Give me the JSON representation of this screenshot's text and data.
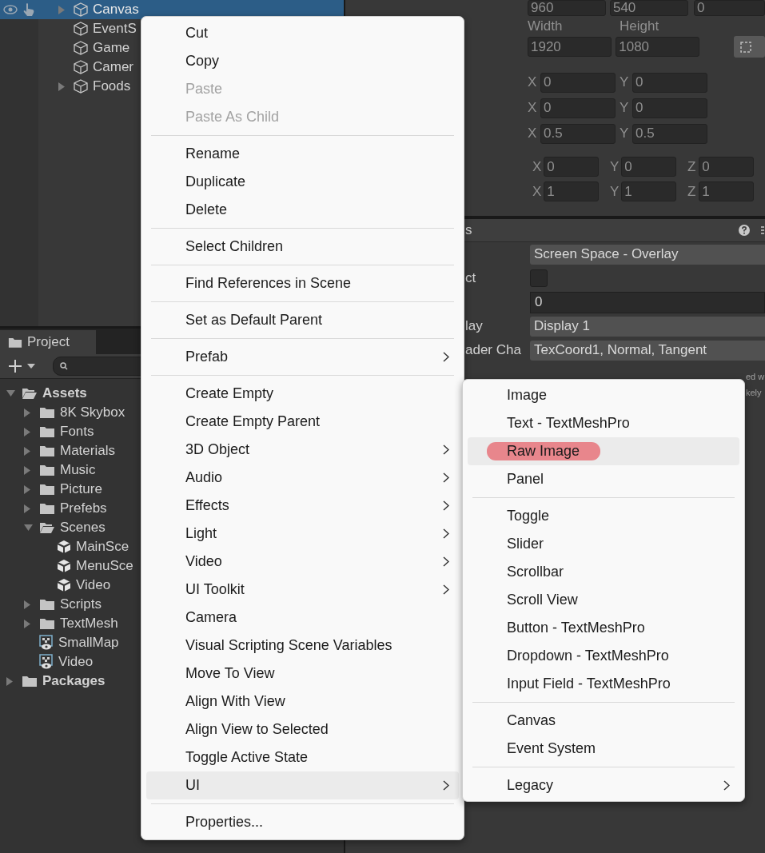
{
  "hierarchy": {
    "items": [
      {
        "label": "Canvas",
        "expandable": true,
        "selected": true
      },
      {
        "label": "EventS",
        "expandable": false,
        "selected": false
      },
      {
        "label": "Game",
        "expandable": false,
        "selected": false
      },
      {
        "label": "Camer",
        "expandable": false,
        "selected": false
      },
      {
        "label": "Foods",
        "expandable": true,
        "selected": false
      }
    ]
  },
  "project": {
    "tab": "Project",
    "tree": [
      {
        "label": "Assets",
        "kind": "folder",
        "expanded": true,
        "children": [
          {
            "label": "8K Skybox",
            "kind": "folder",
            "expanded": false
          },
          {
            "label": "Fonts",
            "kind": "folder",
            "expanded": false
          },
          {
            "label": "Materials",
            "kind": "folder",
            "expanded": false
          },
          {
            "label": "Music",
            "kind": "folder",
            "expanded": false
          },
          {
            "label": "Picture",
            "kind": "folder",
            "expanded": false
          },
          {
            "label": "Prefebs",
            "kind": "folder",
            "expanded": false
          },
          {
            "label": "Scenes",
            "kind": "folder",
            "expanded": true,
            "children": [
              {
                "label": "MainSce",
                "kind": "scene"
              },
              {
                "label": "MenuSce",
                "kind": "scene"
              },
              {
                "label": "Video",
                "kind": "scene"
              }
            ]
          },
          {
            "label": "Scripts",
            "kind": "folder",
            "expanded": false
          },
          {
            "label": "TextMesh",
            "kind": "folder",
            "expanded": false
          },
          {
            "label": "SmallMap",
            "kind": "render_texture"
          },
          {
            "label": "Video",
            "kind": "render_texture"
          }
        ]
      },
      {
        "label": "Packages",
        "kind": "folder",
        "expanded": false
      }
    ]
  },
  "inspector": {
    "top_fields": [
      "960",
      "540",
      "0"
    ],
    "size_labels": [
      "Width",
      "Height"
    ],
    "size_fields": [
      "1920",
      "1080"
    ],
    "vec2_rows": [
      [
        {
          "axis": "X",
          "value": "0"
        },
        {
          "axis": "Y",
          "value": "0"
        }
      ],
      [
        {
          "axis": "X",
          "value": "0"
        },
        {
          "axis": "Y",
          "value": "0"
        }
      ],
      [
        {
          "axis": "X",
          "value": "0.5"
        },
        {
          "axis": "Y",
          "value": "0.5"
        }
      ]
    ],
    "vec3_rows": [
      [
        {
          "axis": "X",
          "value": "0"
        },
        {
          "axis": "Y",
          "value": "0"
        },
        {
          "axis": "Z",
          "value": "0"
        }
      ],
      [
        {
          "axis": "X",
          "value": "1"
        },
        {
          "axis": "Y",
          "value": "1"
        },
        {
          "axis": "Z",
          "value": "1"
        }
      ]
    ],
    "component": {
      "title": "s",
      "rows": [
        {
          "label": "",
          "kind": "dropdown",
          "value": "Screen Space - Overlay"
        },
        {
          "label": "ct",
          "kind": "checkbox",
          "checked": false
        },
        {
          "label": "",
          "kind": "number",
          "value": "0"
        },
        {
          "label": "lay",
          "kind": "dropdown",
          "value": "Display 1"
        },
        {
          "label": "ader Cha",
          "kind": "dropdown",
          "value": "TexCoord1, Normal, Tangent"
        }
      ],
      "notes": [
        "ed w",
        "kely"
      ]
    }
  },
  "menu": {
    "items": [
      {
        "kind": "item",
        "label": "Cut",
        "disabled": false,
        "submenu": false,
        "selected": false
      },
      {
        "kind": "item",
        "label": "Copy",
        "disabled": false,
        "submenu": false,
        "selected": false
      },
      {
        "kind": "item",
        "label": "Paste",
        "disabled": true,
        "submenu": false,
        "selected": false
      },
      {
        "kind": "item",
        "label": "Paste As Child",
        "disabled": true,
        "submenu": false,
        "selected": false
      },
      {
        "kind": "separator"
      },
      {
        "kind": "item",
        "label": "Rename",
        "disabled": false,
        "submenu": false,
        "selected": false
      },
      {
        "kind": "item",
        "label": "Duplicate",
        "disabled": false,
        "submenu": false,
        "selected": false
      },
      {
        "kind": "item",
        "label": "Delete",
        "disabled": false,
        "submenu": false,
        "selected": false
      },
      {
        "kind": "separator"
      },
      {
        "kind": "item",
        "label": "Select Children",
        "disabled": false,
        "submenu": false,
        "selected": false
      },
      {
        "kind": "separator"
      },
      {
        "kind": "item",
        "label": "Find References in Scene",
        "disabled": false,
        "submenu": false,
        "selected": false
      },
      {
        "kind": "separator"
      },
      {
        "kind": "item",
        "label": "Set as Default Parent",
        "disabled": false,
        "submenu": false,
        "selected": false
      },
      {
        "kind": "separator"
      },
      {
        "kind": "item",
        "label": "Prefab",
        "disabled": false,
        "submenu": true,
        "selected": false
      },
      {
        "kind": "separator"
      },
      {
        "kind": "item",
        "label": "Create Empty",
        "disabled": false,
        "submenu": false,
        "selected": false
      },
      {
        "kind": "item",
        "label": "Create Empty Parent",
        "disabled": false,
        "submenu": false,
        "selected": false
      },
      {
        "kind": "item",
        "label": "3D Object",
        "disabled": false,
        "submenu": true,
        "selected": false
      },
      {
        "kind": "item",
        "label": "Audio",
        "disabled": false,
        "submenu": true,
        "selected": false
      },
      {
        "kind": "item",
        "label": "Effects",
        "disabled": false,
        "submenu": true,
        "selected": false
      },
      {
        "kind": "item",
        "label": "Light",
        "disabled": false,
        "submenu": true,
        "selected": false
      },
      {
        "kind": "item",
        "label": "Video",
        "disabled": false,
        "submenu": true,
        "selected": false
      },
      {
        "kind": "item",
        "label": "UI Toolkit",
        "disabled": false,
        "submenu": true,
        "selected": false
      },
      {
        "kind": "item",
        "label": "Camera",
        "disabled": false,
        "submenu": false,
        "selected": false
      },
      {
        "kind": "item",
        "label": "Visual Scripting Scene Variables",
        "disabled": false,
        "submenu": false,
        "selected": false
      },
      {
        "kind": "item",
        "label": "Move To View",
        "disabled": false,
        "submenu": false,
        "selected": false
      },
      {
        "kind": "item",
        "label": "Align With View",
        "disabled": false,
        "submenu": false,
        "selected": false
      },
      {
        "kind": "item",
        "label": "Align View to Selected",
        "disabled": false,
        "submenu": false,
        "selected": false
      },
      {
        "kind": "item",
        "label": "Toggle Active State",
        "disabled": false,
        "submenu": false,
        "selected": false
      },
      {
        "kind": "item",
        "label": "UI",
        "disabled": false,
        "submenu": true,
        "selected": true
      },
      {
        "kind": "separator"
      },
      {
        "kind": "item",
        "label": "Properties...",
        "disabled": false,
        "submenu": false,
        "selected": false
      }
    ]
  },
  "submenu": {
    "items": [
      {
        "kind": "item",
        "label": "Image",
        "submenu": false,
        "selected": false,
        "marked": false
      },
      {
        "kind": "item",
        "label": "Text - TextMeshPro",
        "submenu": false,
        "selected": false,
        "marked": false
      },
      {
        "kind": "item",
        "label": "Raw Image",
        "submenu": false,
        "selected": true,
        "marked": true
      },
      {
        "kind": "item",
        "label": "Panel",
        "submenu": false,
        "selected": false,
        "marked": false
      },
      {
        "kind": "separator"
      },
      {
        "kind": "item",
        "label": "Toggle",
        "submenu": false,
        "selected": false,
        "marked": false
      },
      {
        "kind": "item",
        "label": "Slider",
        "submenu": false,
        "selected": false,
        "marked": false
      },
      {
        "kind": "item",
        "label": "Scrollbar",
        "submenu": false,
        "selected": false,
        "marked": false
      },
      {
        "kind": "item",
        "label": "Scroll View",
        "submenu": false,
        "selected": false,
        "marked": false
      },
      {
        "kind": "item",
        "label": "Button - TextMeshPro",
        "submenu": false,
        "selected": false,
        "marked": false
      },
      {
        "kind": "item",
        "label": "Dropdown - TextMeshPro",
        "submenu": false,
        "selected": false,
        "marked": false
      },
      {
        "kind": "item",
        "label": "Input Field - TextMeshPro",
        "submenu": false,
        "selected": false,
        "marked": false
      },
      {
        "kind": "separator"
      },
      {
        "kind": "item",
        "label": "Canvas",
        "submenu": false,
        "selected": false,
        "marked": false
      },
      {
        "kind": "item",
        "label": "Event System",
        "submenu": false,
        "selected": false,
        "marked": false
      },
      {
        "kind": "separator"
      },
      {
        "kind": "item",
        "label": "Legacy",
        "submenu": true,
        "selected": false,
        "marked": false
      }
    ]
  }
}
